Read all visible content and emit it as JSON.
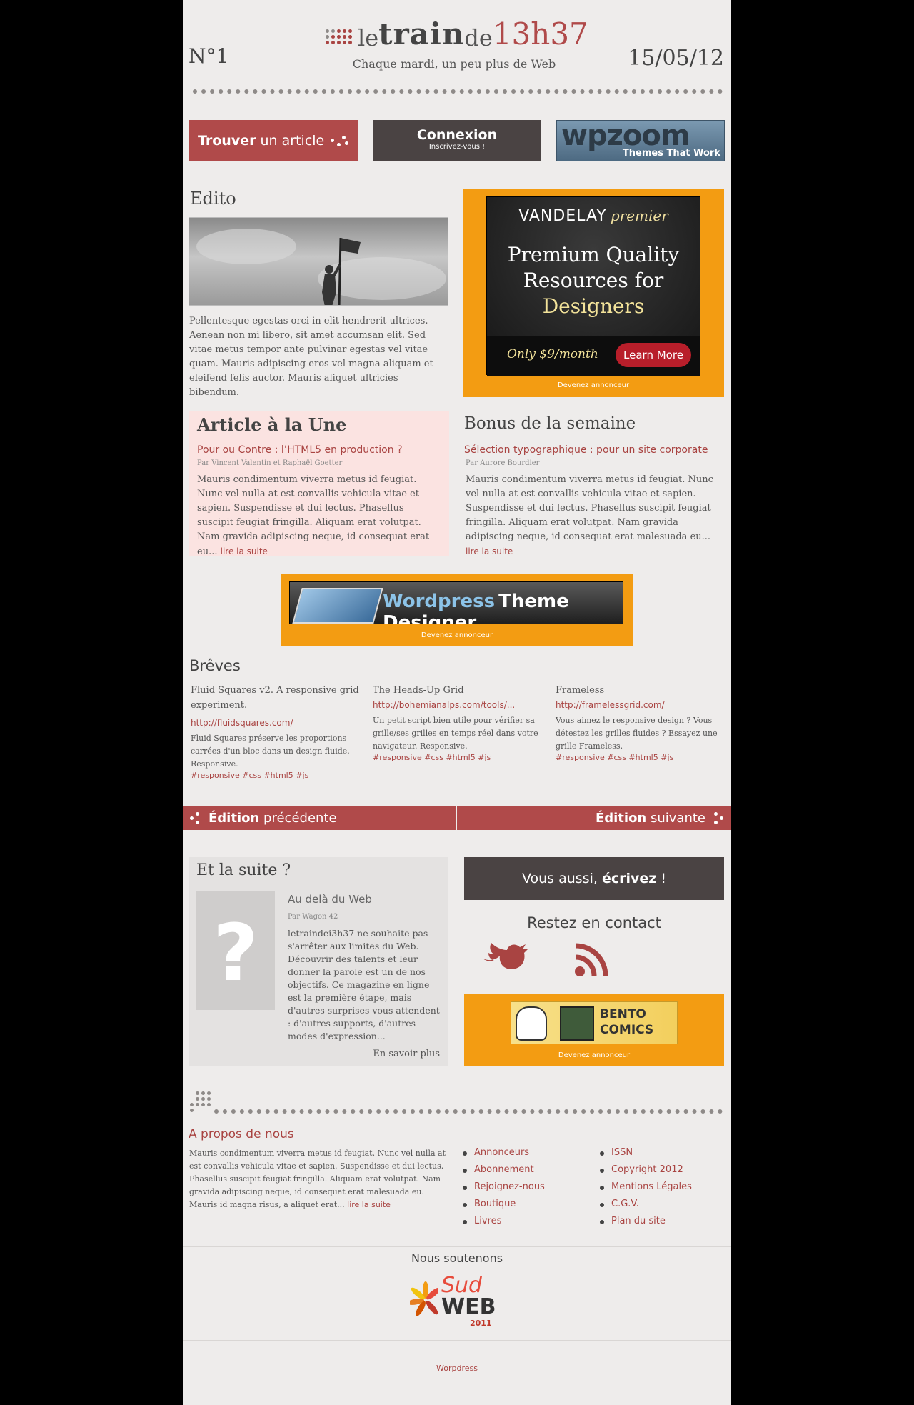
{
  "header": {
    "issue": "N°1",
    "logo_pre": "le",
    "logo_main": "train",
    "logo_de": "de",
    "logo_time": "13h37",
    "tagline": "Chaque mardi, un peu plus de Web",
    "date": "15/05/12"
  },
  "nav": {
    "find_bold": "Trouver",
    "find_rest": "un article",
    "login_title": "Connexion",
    "login_sub": "Inscrivez-vous !",
    "sponsor_name": "wpzoom",
    "sponsor_tag": "Themes That Work"
  },
  "edito": {
    "heading": "Edito",
    "text": "Pellentesque egestas orci in elit hendrerit ultrices. Aenean non mi libero, sit amet accumsan elit. Sed vitae metus tempor ante pulvinar egestas vel vitae quam. Mauris adipiscing eros vel magna aliquam et eleifend felis auctor. Mauris aliquet ultricies bibendum."
  },
  "ad_vandelay": {
    "brand": "VANDELAY",
    "brand_italic": "premier",
    "line1": "Premium Quality",
    "line2": "Resources for",
    "line3": "Designers",
    "price": "Only $9/month",
    "cta": "Learn More",
    "footer": "Devenez annonceur"
  },
  "featured": {
    "heading": "Article à la Une",
    "title": "Pour ou Contre : l’HTML5 en production ?",
    "author": "Par Vincent Valentin et Raphaël Goetter",
    "text": "Mauris condimentum viverra metus id feugiat. Nunc vel nulla at est convallis vehicula vitae et sapien. Suspendisse et dui lectus. Phasellus suscipit feugiat fringilla. Aliquam erat volutpat. Nam gravida adipiscing neque, id consequat erat eu...",
    "more": "lire la suite"
  },
  "bonus": {
    "heading": "Bonus de la semaine",
    "title": "Sélection typographique : pour un site corporate",
    "author": "Par Aurore Bourdier",
    "text": "Mauris condimentum viverra metus id feugiat. Nunc vel nulla at est convallis vehicula vitae et sapien. Suspendisse et dui lectus. Phasellus suscipit feugiat fringilla. Aliquam erat volutpat. Nam gravida adipiscing neque, id consequat erat malesuada eu...",
    "more": "lire la suite"
  },
  "ad_wp": {
    "word1": "Wordpress",
    "word2": "Theme Designer",
    "footer": "Devenez annonceur"
  },
  "breves": {
    "heading": "Brêves",
    "items": [
      {
        "title": "Fluid Squares v2. A responsive grid experiment.",
        "url": "http://fluidsquares.com/",
        "desc": "Fluid Squares préserve les proportions carrées d'un bloc dans un design fluide. Responsive.",
        "tags": "#responsive #css #html5 #js"
      },
      {
        "title": "The Heads-Up Grid",
        "url": "http://bohemianalps.com/tools/...",
        "desc": "Un petit script bien utile pour vérifier sa grille/ses grilles en temps réel dans votre navigateur. Responsive.",
        "tags": "#responsive #css #html5 #js"
      },
      {
        "title": "Frameless",
        "url": "http://framelessgrid.com/",
        "desc": "Vous aimez le responsive design ? Vous détestez les grilles fluides ? Essayez une grille Frameless.",
        "tags": "#responsive #css #html5 #js"
      }
    ]
  },
  "editions": {
    "prev_bold": "Édition",
    "prev_rest": "précédente",
    "next_bold": "Édition",
    "next_rest": "suivante"
  },
  "suite": {
    "heading": "Et la suite ?",
    "placeholder": "?",
    "title": "Au delà du Web",
    "author": "Par Wagon 42",
    "text": "letraindei3h37 ne souhaite pas s'arrêter aux limites du Web. Découvrir des talents et leur donner la parole est un de nos objectifs. Ce magazine en ligne est la première étape, mais d'autres surprises vous attendent : d'autres supports, d'autres modes d'expression...",
    "more": "En savoir plus"
  },
  "write": {
    "pre": "Vous aussi,",
    "bold": "écrivez",
    "post": "!"
  },
  "contact": {
    "heading": "Restez en contact"
  },
  "ad_bento": {
    "text": "BENTO COMICS",
    "footer": "Devenez annonceur"
  },
  "about": {
    "heading": "A propos de nous",
    "text": "Mauris condimentum viverra metus id feugiat. Nunc vel nulla at est convallis vehicula vitae et sapien. Suspendisse et dui lectus. Phasellus suscipit feugiat fringilla. Aliquam erat volutpat. Nam gravida adipiscing neque, id consequat erat malesuada eu. Mauris id magna risus, a aliquet erat...",
    "more": "lire la suite",
    "links1": [
      "Annonceurs",
      "Abonnement",
      "Rejoignez-nous",
      "Boutique",
      "Livres"
    ],
    "links2": [
      "ISSN",
      "Copyright 2012",
      "Mentions Légales",
      "C.G.V.",
      "Plan du site"
    ]
  },
  "support": {
    "heading": "Nous soutenons",
    "sud": "Sud",
    "web": "WEB",
    "year": "2011"
  },
  "footer": {
    "credit": "Worpdress"
  },
  "colors": {
    "accent_red": "#a94442",
    "button_red": "#b04a4a",
    "dark": "#4a4343",
    "orange": "#f39c12",
    "featured_bg": "#fbe3e1"
  }
}
